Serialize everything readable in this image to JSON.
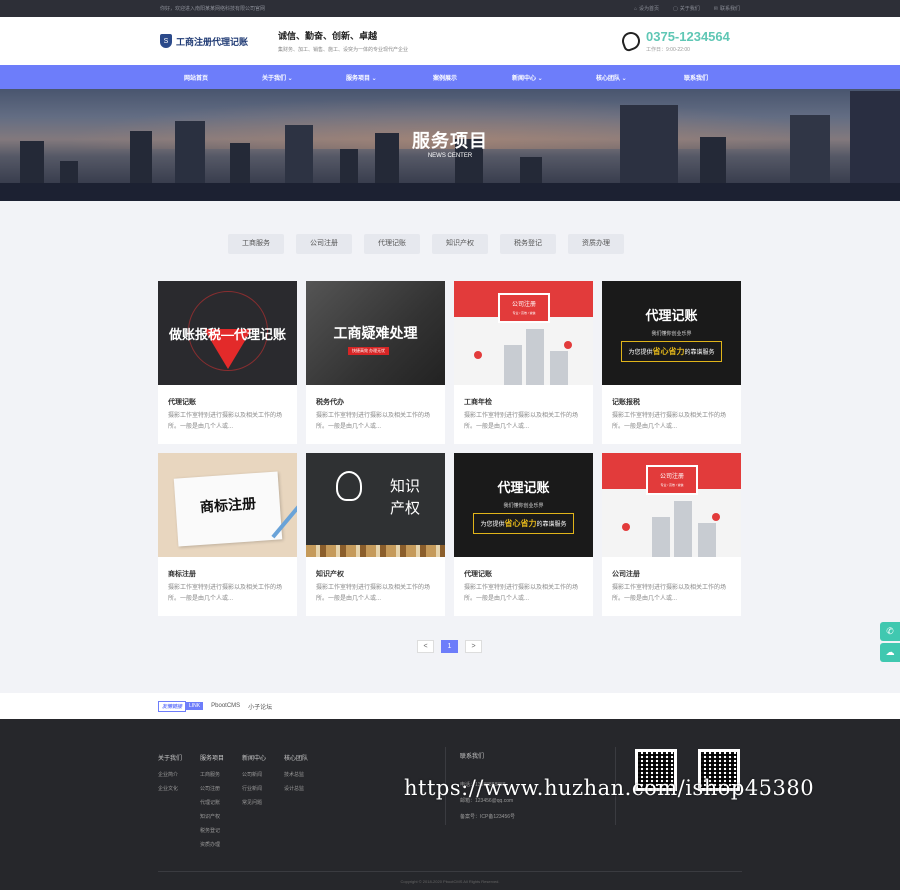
{
  "topbar": {
    "welcome": "你好，欢迎进入南阳某某网络科技有限公司官网",
    "links": [
      "设为首页",
      "关于我们",
      "联系我们"
    ]
  },
  "header": {
    "logo_text": "工商注册代理记账",
    "slogan_main": "诚信、勤奋、创新、卓越",
    "slogan_sub": "集财务、加工、销售、施工、设突为一体的专业现代产企业",
    "phone": "0375-1234564",
    "hours": "工作日：9:00-22:00"
  },
  "nav": {
    "items": [
      "网站首页",
      "关于我们",
      "服务项目",
      "案例展示",
      "新闻中心",
      "核心团队",
      "联系我们"
    ]
  },
  "banner": {
    "title": "服务项目",
    "subtitle": "NEWS CENTER"
  },
  "tabs": [
    "工商服务",
    "公司注册",
    "代理记账",
    "知识产权",
    "税务登记",
    "资质办理"
  ],
  "cards": [
    {
      "title": "代理记账",
      "desc": "摄影工作室特别进行摄影以及相关工作的场所。一般是由几个人或...",
      "image_text": "做账报税—代理记账"
    },
    {
      "title": "税务代办",
      "desc": "摄影工作室特别进行摄影以及相关工作的场所。一般是由几个人或...",
      "image_text": "工商疑难处理",
      "image_tag": "快捷高效 办理无忧"
    },
    {
      "title": "工商年检",
      "desc": "摄影工作室特别进行摄影以及相关工作的场所。一般是由几个人或...",
      "image_text": "公司注册",
      "image_sub": "专业 / 高效 / 诚信"
    },
    {
      "title": "记账报税",
      "desc": "摄影工作室特别进行摄影以及相关工作的场所。一般是由几个人或...",
      "image_text": "代理记账",
      "image_mid": "我们懂你创业乐界",
      "image_bar_a": "为您提供",
      "image_bar_b": "省心省力",
      "image_bar_c": "的靠谱服务"
    },
    {
      "title": "商标注册",
      "desc": "摄影工作室特别进行摄影以及相关工作的场所。一般是由几个人或...",
      "image_text": "商标注册"
    },
    {
      "title": "知识产权",
      "desc": "摄影工作室特别进行摄影以及相关工作的场所。一般是由几个人或...",
      "image_text": "知识产权"
    },
    {
      "title": "代理记账",
      "desc": "摄影工作室特别进行摄影以及相关工作的场所。一般是由几个人或...",
      "image_text": "代理记账",
      "image_mid": "我们懂你创业乐界",
      "image_bar_a": "为您提供",
      "image_bar_b": "省心省力",
      "image_bar_c": "的靠谱服务"
    },
    {
      "title": "公司注册",
      "desc": "摄影工作室特别进行摄影以及相关工作的场所。一般是由几个人或...",
      "image_text": "公司注册",
      "image_sub": "专业 / 高效 / 诚信"
    }
  ],
  "pager": {
    "prev": "<",
    "current": "1",
    "next": ">"
  },
  "friend_links": {
    "label": "友情链接",
    "label_en": "LINK",
    "items": [
      "PbootCMS",
      "小子论坛"
    ]
  },
  "footer": {
    "cols": [
      {
        "head": "关于我们",
        "items": [
          "企业简介",
          "企业文化"
        ]
      },
      {
        "head": "服务项目",
        "items": [
          "工商服务",
          "公司注册",
          "代理记账",
          "知识产权",
          "税务登记",
          "资质办理"
        ]
      },
      {
        "head": "新闻中心",
        "items": [
          "公司新闻",
          "行业新闻",
          "常见问题"
        ]
      },
      {
        "head": "核心团队",
        "items": [
          "技术总监",
          "设计总监"
        ]
      }
    ],
    "contact": {
      "head": "联系我们",
      "phone": "电话：13988888888",
      "email": "邮箱：123456@qq.com",
      "icp": "备案号：ICP备123456号"
    },
    "qr_captions": [
      "",
      ""
    ],
    "copyright": "Copyright © 2018-2020 PbootCMS All Rights Reserved."
  },
  "watermark": "https://www.huzhan.com/ishop45380"
}
